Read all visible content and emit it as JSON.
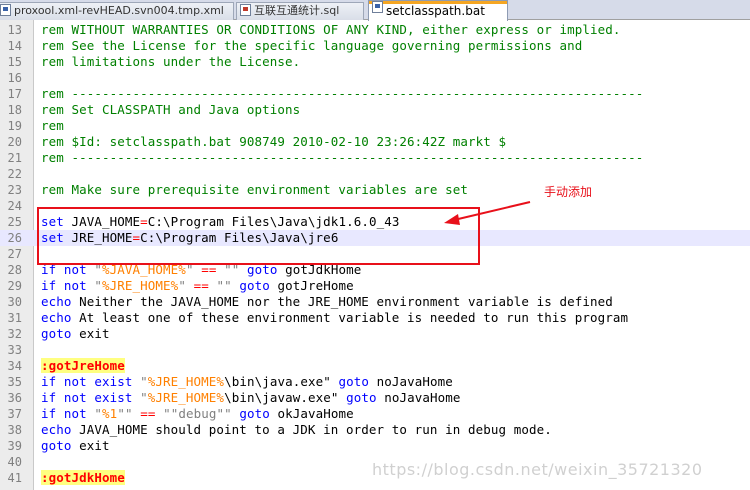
{
  "tabs": [
    {
      "label": "proxool.xml-revHEAD.svn004.tmp.xml",
      "icon": "saved-file-icon",
      "active": false
    },
    {
      "label": "互联互通统计.sql",
      "icon": "unsaved-file-icon",
      "active": false
    },
    {
      "label": "setclasspath.bat",
      "icon": "saved-file-icon",
      "active": true
    }
  ],
  "lines": [
    {
      "n": "13",
      "segs": [
        [
          "rem WITHOUT WARRANTIES OR CONDITIONS OF ANY KIND, either express or implied.",
          "rem"
        ]
      ]
    },
    {
      "n": "14",
      "segs": [
        [
          "rem See the License for the specific language governing permissions and",
          "rem"
        ]
      ]
    },
    {
      "n": "15",
      "segs": [
        [
          "rem limitations under the License.",
          "rem"
        ]
      ]
    },
    {
      "n": "16",
      "segs": []
    },
    {
      "n": "17",
      "segs": [
        [
          "rem ---------------------------------------------------------------------------",
          "rem"
        ]
      ]
    },
    {
      "n": "18",
      "segs": [
        [
          "rem Set CLASSPATH and Java options",
          "rem"
        ]
      ]
    },
    {
      "n": "19",
      "segs": [
        [
          "rem",
          "rem"
        ]
      ]
    },
    {
      "n": "20",
      "segs": [
        [
          "rem $Id: setclasspath.bat 908749 2010-02-10 23:26:42Z markt $",
          "rem"
        ]
      ]
    },
    {
      "n": "21",
      "segs": [
        [
          "rem ---------------------------------------------------------------------------",
          "rem"
        ]
      ]
    },
    {
      "n": "22",
      "segs": []
    },
    {
      "n": "23",
      "segs": [
        [
          "rem Make sure prerequisite environment variables are set",
          "rem"
        ]
      ]
    },
    {
      "n": "24",
      "segs": []
    },
    {
      "n": "25",
      "segs": [
        [
          "set",
          "kw"
        ],
        [
          " JAVA_HOME",
          ""
        ],
        [
          "=",
          "op"
        ],
        [
          "C:\\Program Files\\Java\\jdk1.6.0_43",
          ""
        ]
      ]
    },
    {
      "n": "26",
      "cur": true,
      "segs": [
        [
          "set",
          "kw"
        ],
        [
          " JRE_HOME",
          ""
        ],
        [
          "=",
          "op"
        ],
        [
          "C:\\Program Files\\Java\\jre6",
          ""
        ]
      ]
    },
    {
      "n": "27",
      "segs": []
    },
    {
      "n": "28",
      "segs": [
        [
          "if not",
          "kw"
        ],
        [
          " ",
          ""
        ],
        [
          "\"",
          "str"
        ],
        [
          "%JAVA_HOME%",
          "var"
        ],
        [
          "\"",
          "str"
        ],
        [
          " ",
          ""
        ],
        [
          "==",
          "op"
        ],
        [
          " ",
          ""
        ],
        [
          "\"\"",
          "str"
        ],
        [
          " ",
          ""
        ],
        [
          "goto",
          "kw"
        ],
        [
          " gotJdkHome",
          ""
        ]
      ]
    },
    {
      "n": "29",
      "segs": [
        [
          "if not",
          "kw"
        ],
        [
          " ",
          ""
        ],
        [
          "\"",
          "str"
        ],
        [
          "%JRE_HOME%",
          "var"
        ],
        [
          "\"",
          "str"
        ],
        [
          " ",
          ""
        ],
        [
          "==",
          "op"
        ],
        [
          " ",
          ""
        ],
        [
          "\"\"",
          "str"
        ],
        [
          " ",
          ""
        ],
        [
          "goto",
          "kw"
        ],
        [
          " gotJreHome",
          ""
        ]
      ]
    },
    {
      "n": "30",
      "segs": [
        [
          "echo",
          "kw"
        ],
        [
          " Neither the JAVA_HOME nor the JRE_HOME environment variable is defined",
          ""
        ]
      ]
    },
    {
      "n": "31",
      "segs": [
        [
          "echo",
          "kw"
        ],
        [
          " At least one of these environment variable is needed to run this program",
          ""
        ]
      ]
    },
    {
      "n": "32",
      "segs": [
        [
          "goto",
          "kw"
        ],
        [
          " exit",
          ""
        ]
      ]
    },
    {
      "n": "33",
      "segs": []
    },
    {
      "n": "34",
      "segs": [
        [
          ":gotJreHome",
          "lab"
        ]
      ]
    },
    {
      "n": "35",
      "segs": [
        [
          "if not exist",
          "kw"
        ],
        [
          " ",
          ""
        ],
        [
          "\"",
          "str"
        ],
        [
          "%JRE_HOME%",
          "var"
        ],
        [
          "\\bin\\java.exe\"",
          ""
        ],
        [
          " ",
          ""
        ],
        [
          "goto",
          "kw"
        ],
        [
          " noJavaHome",
          ""
        ]
      ]
    },
    {
      "n": "36",
      "segs": [
        [
          "if not exist",
          "kw"
        ],
        [
          " ",
          ""
        ],
        [
          "\"",
          "str"
        ],
        [
          "%JRE_HOME%",
          "var"
        ],
        [
          "\\bin\\javaw.exe\"",
          ""
        ],
        [
          " ",
          ""
        ],
        [
          "goto",
          "kw"
        ],
        [
          " noJavaHome",
          ""
        ]
      ]
    },
    {
      "n": "37",
      "segs": [
        [
          "if not",
          "kw"
        ],
        [
          " ",
          ""
        ],
        [
          "\"",
          "str"
        ],
        [
          "%1",
          "var"
        ],
        [
          "\"\"",
          "str"
        ],
        [
          " ",
          ""
        ],
        [
          "==",
          "op"
        ],
        [
          " ",
          ""
        ],
        [
          "\"\"debug\"\"",
          "str"
        ],
        [
          " ",
          ""
        ],
        [
          "goto",
          "kw"
        ],
        [
          " okJavaHome",
          ""
        ]
      ]
    },
    {
      "n": "38",
      "segs": [
        [
          "echo",
          "kw"
        ],
        [
          " JAVA_HOME should point to a JDK in order to run in debug mode.",
          ""
        ]
      ]
    },
    {
      "n": "39",
      "segs": [
        [
          "goto",
          "kw"
        ],
        [
          " exit",
          ""
        ]
      ]
    },
    {
      "n": "40",
      "segs": []
    },
    {
      "n": "41",
      "segs": [
        [
          ":gotJdkHome",
          "lab"
        ]
      ]
    }
  ],
  "annotation": {
    "note": "手动添加"
  },
  "watermark": "https://blog.csdn.net/weixin_35721320",
  "colors": {
    "comment": "#008000",
    "keyword": "#0000ff",
    "operator": "#ff0000",
    "variable": "#ff8000",
    "annotation_red": "#e8101a"
  }
}
